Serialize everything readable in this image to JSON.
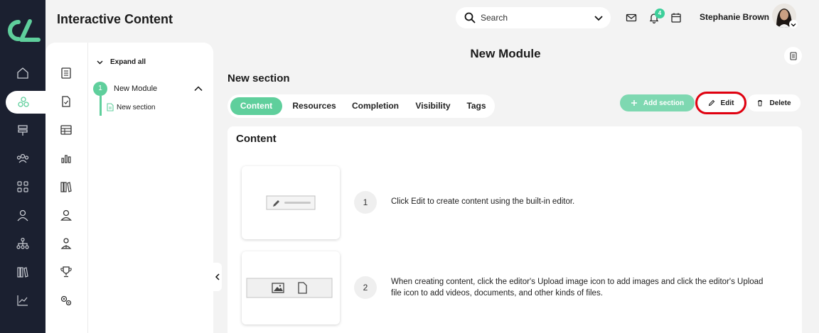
{
  "app": {
    "title": "Interactive Content",
    "logo_icon": "brand-logo-icon"
  },
  "header": {
    "search_placeholder": "Search",
    "notification_count": "4",
    "user_name": "Stephanie Brown"
  },
  "rail": {
    "items": [
      "home-icon",
      "content-icon",
      "sign-icon",
      "users-icon",
      "apps-icon",
      "person-icon",
      "org-chart-icon",
      "library-icon",
      "analytics-icon"
    ],
    "active": "content-icon"
  },
  "tree": {
    "expand_all_label": "Expand all",
    "module_number": "1",
    "module_name": "New Module",
    "section_name": "New section"
  },
  "main": {
    "module_title": "New Module",
    "section_title": "New section",
    "tabs": [
      {
        "label": "Content",
        "active": true
      },
      {
        "label": "Resources",
        "active": false
      },
      {
        "label": "Completion",
        "active": false
      },
      {
        "label": "Visibility",
        "active": false
      },
      {
        "label": "Tags",
        "active": false
      }
    ],
    "actions": {
      "add_section_label": "Add section",
      "edit_label": "Edit",
      "delete_label": "Delete"
    },
    "content": {
      "heading": "Content",
      "steps": [
        {
          "number": "1",
          "text": "Click Edit to create content using the built-in editor."
        },
        {
          "number": "2",
          "text": "When creating content, click the editor's Upload image icon to add images and click the editor's Upload file icon to add videos, documents, and other kinds of files."
        }
      ]
    }
  },
  "colors": {
    "rail_bg": "#1b2030",
    "accent_green": "#5fcf9c",
    "highlight_red": "#e0000f"
  }
}
